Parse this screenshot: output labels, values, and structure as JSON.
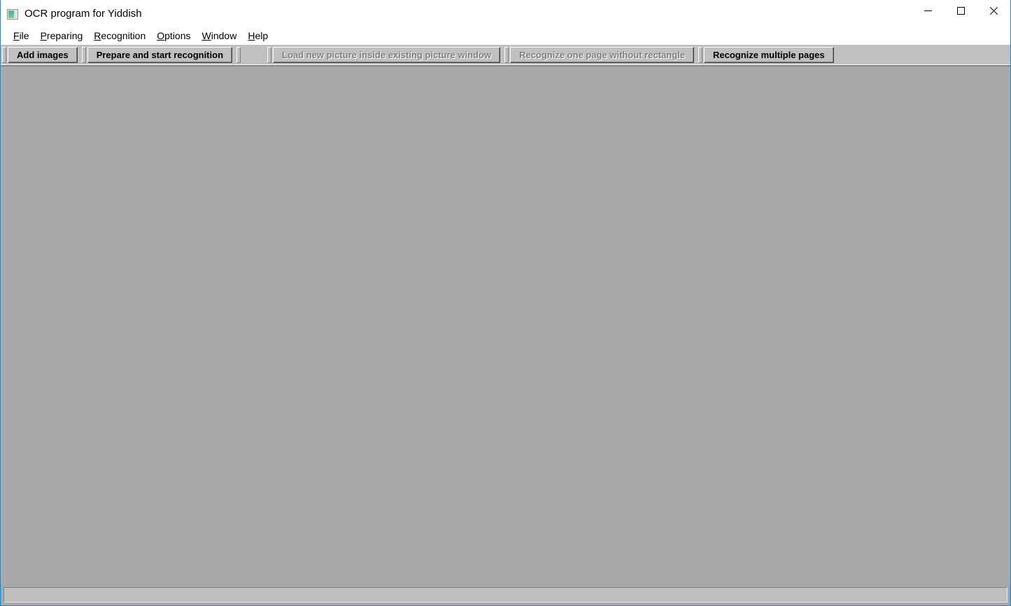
{
  "window": {
    "title": "OCR program for Yiddish",
    "icon": "picture-document-icon",
    "accent_color": "#2a8fd4",
    "titlebar_bg": "#ffffff",
    "client_bg": "#a9a9a9",
    "toolbar_bg": "#c0c0c0"
  },
  "caption_buttons": [
    {
      "name": "minimize",
      "label": "Minimize",
      "glyph": "minimize-icon"
    },
    {
      "name": "maximize",
      "label": "Maximize",
      "glyph": "maximize-icon"
    },
    {
      "name": "close",
      "label": "Close",
      "glyph": "close-icon"
    }
  ],
  "menubar": {
    "items": [
      {
        "label": "File",
        "accel": "F"
      },
      {
        "label": "Preparing",
        "accel": "P"
      },
      {
        "label": "Recognition",
        "accel": "R"
      },
      {
        "label": "Options",
        "accel": "O"
      },
      {
        "label": "Window",
        "accel": "W"
      },
      {
        "label": "Help",
        "accel": "H"
      }
    ]
  },
  "toolbar": {
    "buttons": [
      {
        "label": "Add images",
        "enabled": true
      },
      {
        "label": "Prepare and start recognition",
        "enabled": true
      },
      {
        "label": "Load new picture inside existing picture window",
        "enabled": false
      },
      {
        "label": "Recognize one page without rectangle",
        "enabled": false
      },
      {
        "label": "Recognize multiple pages",
        "enabled": true
      }
    ]
  },
  "client": {
    "content": ""
  },
  "statusbar": {
    "text": ""
  }
}
